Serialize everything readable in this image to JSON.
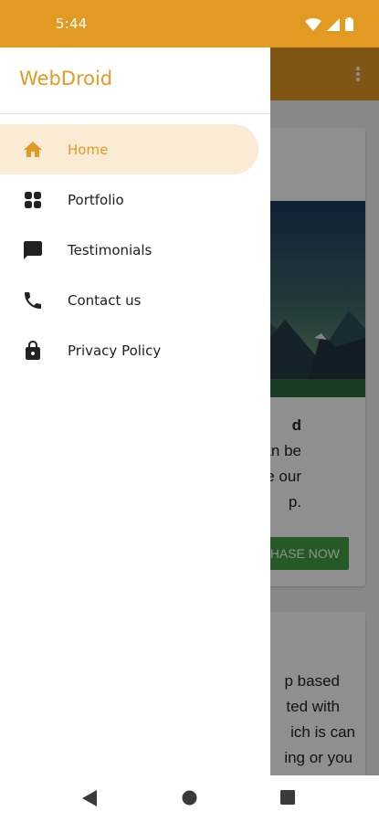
{
  "status_bar": {
    "time": "5:44"
  },
  "drawer": {
    "title": "WebDroid",
    "items": [
      {
        "label": "Home",
        "icon": "home-icon",
        "active": true
      },
      {
        "label": "Portfolio",
        "icon": "grid-icon"
      },
      {
        "label": "Testimonials",
        "icon": "chat-icon"
      },
      {
        "label": "Contact us",
        "icon": "phone-icon"
      },
      {
        "label": "Privacy Policy",
        "icon": "lock-icon"
      }
    ]
  },
  "background": {
    "card1_lines": [
      "d",
      "an be",
      "e our",
      "p."
    ],
    "buy_button": "HASE NOW",
    "card2_lines": [
      "p based",
      "ted with",
      "ich is can",
      "ing or you"
    ]
  },
  "colors": {
    "accent": "#E29A22",
    "active_bg": "#FAEBD4",
    "buy_button": "#43A047"
  }
}
